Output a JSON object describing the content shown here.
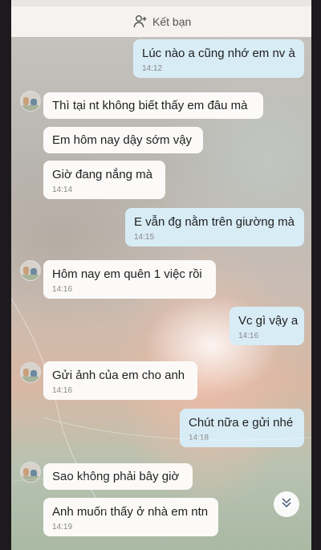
{
  "header": {
    "add_friend_label": "Kết bạn"
  },
  "messages": [
    {
      "dir": "out",
      "text": "Lúc nào a cũng nhớ em nv à",
      "time": "14:12"
    },
    {
      "dir": "in",
      "text": "Thì tại nt không biết thấy em đâu mà",
      "time": ""
    },
    {
      "dir": "in",
      "text": "Em hôm nay dậy sớm vậy",
      "time": ""
    },
    {
      "dir": "in",
      "text": "Giờ đang nắng mà",
      "time": "14:14"
    },
    {
      "dir": "out",
      "text": "E vẫn đg nằm trên giường mà",
      "time": "14:15"
    },
    {
      "dir": "in",
      "text": "Hôm nay em quên 1 việc rồi",
      "time": "14:16"
    },
    {
      "dir": "out",
      "text": "Vc gì vậy a",
      "time": "14:16"
    },
    {
      "dir": "in",
      "text": "Gửi ảnh của em cho anh",
      "time": "14:16"
    },
    {
      "dir": "out",
      "text": "Chút nữa e gửi nhé",
      "time": "14:18"
    },
    {
      "dir": "in",
      "text": "Sao không phải bây giờ",
      "time": ""
    },
    {
      "dir": "in",
      "text": "Anh muốn thấy ở nhà em ntn",
      "time": "14:19"
    }
  ],
  "icons": {
    "add_friend": "person-plus-icon",
    "scroll_down": "double-chevron-down-icon",
    "avatar": "contact-avatar"
  },
  "colors": {
    "incoming_bubble": "#fbfaf8",
    "outgoing_bubble": "#d8ecf6",
    "timestamp": "#888888"
  }
}
